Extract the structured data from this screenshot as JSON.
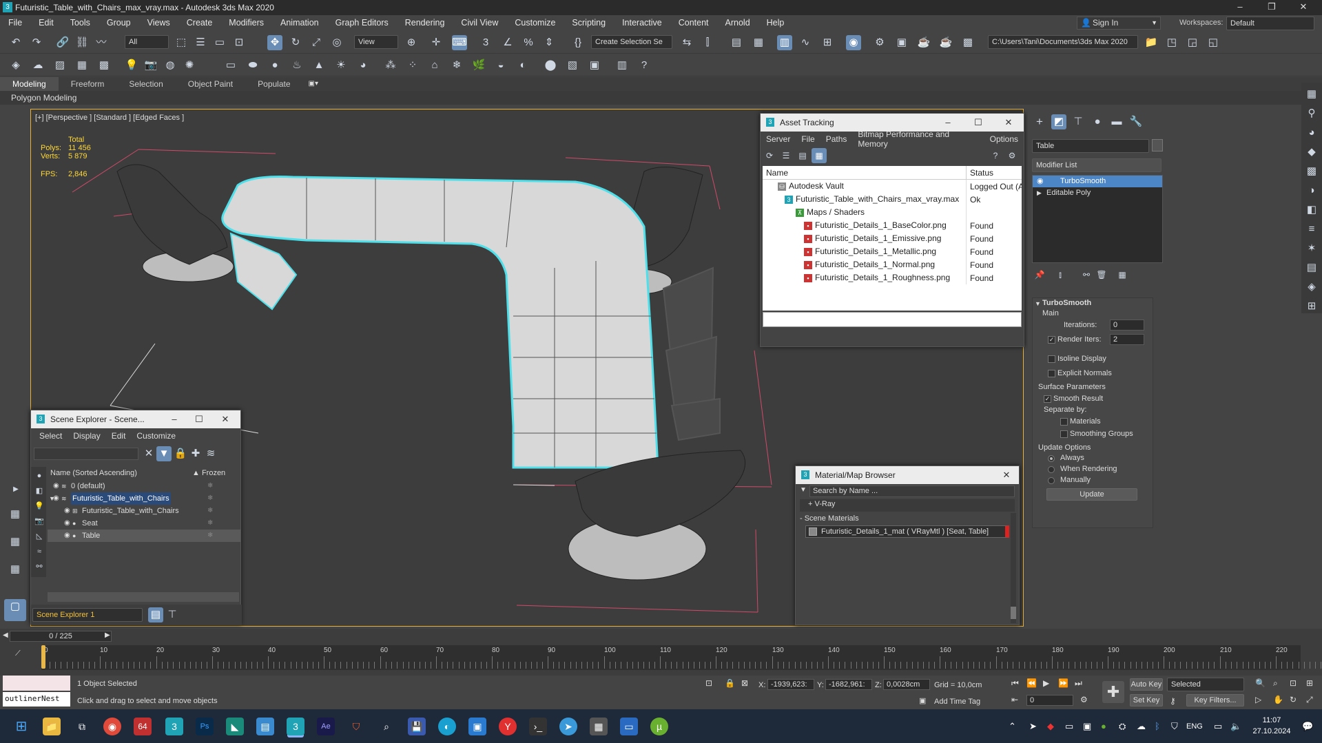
{
  "window": {
    "title": "Futuristic_Table_with_Chairs_max_vray.max - Autodesk 3ds Max 2020",
    "min": "–",
    "max": "❐",
    "close": "✕"
  },
  "menu": [
    "File",
    "Edit",
    "Tools",
    "Group",
    "Views",
    "Create",
    "Modifiers",
    "Animation",
    "Graph Editors",
    "Rendering",
    "Civil View",
    "Customize",
    "Scripting",
    "Interactive",
    "Content",
    "Arnold",
    "Help"
  ],
  "account": {
    "signin": "Sign In",
    "workspaces_label": "Workspaces:",
    "workspace": "Default"
  },
  "toolbar": {
    "filter": "All",
    "refcoord": "View",
    "selection_set": "Create Selection Se",
    "path": "C:\\Users\\Tani\\Documents\\3ds Max 2020"
  },
  "ribbon": {
    "tabs": [
      "Modeling",
      "Freeform",
      "Selection",
      "Object Paint",
      "Populate"
    ],
    "sub": "Polygon Modeling"
  },
  "viewport": {
    "label": "[+] [Perspective ] [Standard ] [Edged Faces ]",
    "stats": {
      "total": "Total",
      "polys_label": "Polys:",
      "polys": "11 456",
      "verts_label": "Verts:",
      "verts": "5 879",
      "fps_label": "FPS:",
      "fps": "2,846"
    }
  },
  "asset_tracking": {
    "title": "Asset Tracking",
    "menu": [
      "Server",
      "File",
      "Paths",
      "Bitmap Performance and Memory",
      "Options"
    ],
    "col_name": "Name",
    "col_status": "Status",
    "rows": [
      {
        "name": "Autodesk Vault",
        "status": "Logged Out (A"
      },
      {
        "name": "Futuristic_Table_with_Chairs_max_vray.max",
        "status": "Ok"
      },
      {
        "name": "Maps / Shaders",
        "status": ""
      },
      {
        "name": "Futuristic_Details_1_BaseColor.png",
        "status": "Found"
      },
      {
        "name": "Futuristic_Details_1_Emissive.png",
        "status": "Found"
      },
      {
        "name": "Futuristic_Details_1_Metallic.png",
        "status": "Found"
      },
      {
        "name": "Futuristic_Details_1_Normal.png",
        "status": "Found"
      },
      {
        "name": "Futuristic_Details_1_Roughness.png",
        "status": "Found"
      }
    ]
  },
  "scene_explorer": {
    "title": "Scene Explorer - Scene...",
    "menu": [
      "Select",
      "Display",
      "Edit",
      "Customize"
    ],
    "col_name": "Name (Sorted Ascending)",
    "col_frozen": "▲ Frozen",
    "rows": [
      "0 (default)",
      "Futuristic_Table_with_Chairs",
      "Futuristic_Table_with_Chairs",
      "Seat",
      "Table"
    ],
    "footer": "Scene Explorer 1"
  },
  "material_browser": {
    "title": "Material/Map Browser",
    "search_placeholder": "Search by Name ...",
    "vray": "+ V-Ray",
    "section": "- Scene Materials",
    "material": "Futuristic_Details_1_mat ( VRayMtl ) [Seat, Table]"
  },
  "command_panel": {
    "object_name": "Table",
    "modifier_list": "Modifier List",
    "stack": [
      "TurboSmooth",
      "Editable Poly"
    ],
    "rollout": "TurboSmooth",
    "main": "Main",
    "iterations_label": "Iterations:",
    "iterations": "0",
    "render_iters_label": "Render Iters:",
    "render_iters": "2",
    "isoline": "Isoline Display",
    "explicit": "Explicit Normals",
    "surface": "Surface Parameters",
    "smooth_result": "Smooth Result",
    "separate_by": "Separate by:",
    "materials": "Materials",
    "smoothing_groups": "Smoothing Groups",
    "update_options": "Update Options",
    "always": "Always",
    "when_rendering": "When Rendering",
    "manually": "Manually",
    "update_btn": "Update"
  },
  "timeline": {
    "frame": "0 / 225",
    "ticks": [
      "0",
      "10",
      "20",
      "30",
      "40",
      "50",
      "60",
      "70",
      "80",
      "90",
      "100",
      "110",
      "120",
      "130",
      "140",
      "150",
      "160",
      "170",
      "180",
      "190",
      "200",
      "210",
      "220"
    ]
  },
  "status": {
    "maxscript": "outlinerNest",
    "selected": "1 Object Selected",
    "hint": "Click and drag to select and move objects",
    "x_label": "X:",
    "x": "-1939,623:",
    "y_label": "Y:",
    "y": "-1682,961:",
    "z_label": "Z:",
    "z": "0,0028cm",
    "grid": "Grid = 10,0cm",
    "add_time_tag": "Add Time Tag",
    "auto_key": "Auto Key",
    "set_key": "Set Key",
    "selected_dd": "Selected",
    "key_filters": "Key Filters...",
    "frame_field": "0"
  },
  "taskbar": {
    "lang": "ENG",
    "time": "11:07",
    "date": "27.10.2024",
    "badge": "64"
  }
}
